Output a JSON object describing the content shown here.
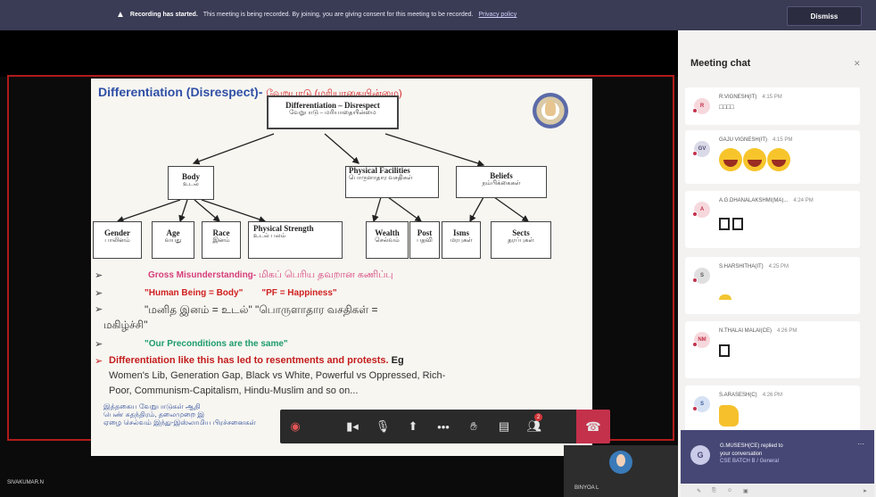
{
  "banner": {
    "title": "Recording has started.",
    "message": "This meeting is being recorded. By joining, you are giving consent for this meeting to be recorded.",
    "link": "Privacy policy",
    "dismiss": "Dismiss"
  },
  "slide": {
    "title_en": "Differentiation (Disrespect)-",
    "title_ta": "வேறுபாடு (மரியாதையின்மை)",
    "top_box": {
      "en": "Differentiation",
      "en2": "– Disrespect",
      "ta": "வேறுபாடு – மரியாதையின்மை"
    },
    "mid_boxes": [
      {
        "en": "Body",
        "ta": "உடல்"
      },
      {
        "en": "Physical Facilities",
        "ta": "பொருளாதார வசதிகள்"
      },
      {
        "en": "Beliefs",
        "ta": "நம்பிக்கைகள்"
      }
    ],
    "leaf_boxes": [
      {
        "en": "Gender",
        "ta": "பாலினம்"
      },
      {
        "en": "Age",
        "ta": "வயது"
      },
      {
        "en": "Race",
        "ta": "இனம்"
      },
      {
        "en": "Physical Strength",
        "ta": "உடல் பலம்"
      },
      {
        "en": "Wealth",
        "ta": "செல்வம்"
      },
      {
        "en": "Post",
        "ta": "பதவி"
      },
      {
        "en": "Isms",
        "ta": "மரபுகள்"
      },
      {
        "en": "Sects",
        "ta": "தரப்புகள்"
      }
    ],
    "bullet1_en": "Gross Misunderstanding-",
    "bullet1_ta": "மிகப் பெரிய தவறான கணிப்பு",
    "bullet2a": "\"Human Being = Body\"",
    "bullet2b": "\"PF = Happiness\"",
    "bullet3_line1": "\"மனித இனம் = உடல்\" \"பொருளாதார வசதிகள் =",
    "bullet3_line2": "மகிழ்ச்சி\"",
    "bullet4": "\"Our Preconditions are the same\"",
    "bullet5_red": "Differentiation like this has led to resentments and protests.",
    "bullet5_eg": "Eg",
    "bullet5_line2": "Women's Lib, Generation Gap, Black vs White, Powerful vs Oppressed, Rich-",
    "bullet5_line3": "Poor, Communism-Capitalism, Hindu-Muslim and so on...",
    "bottom_ta1": "இத்தகைய வேறுபாடுகள் ஆதி",
    "bottom_ta2": "பெண் சுதந்திரம், தலைமுறை இ",
    "bottom_ta3": "ஏழை செல்வம் இந்து-இஸ்லாமிய பிரச்சனைகள்"
  },
  "controls": {
    "items": [
      "record-icon",
      "camera-icon",
      "mic-icon",
      "share-icon",
      "more-icon",
      "raise-hand-icon",
      "chat-icon",
      "participants-icon",
      "hangup-icon"
    ],
    "participants_badge": "2"
  },
  "self_view": {
    "name": "BINYOA L"
  },
  "bottom_name": "SIVAKUMAR.N",
  "chat": {
    "title": "Meeting chat",
    "messages": [
      {
        "initials": "R",
        "name": "R.VIGNESH(IT)",
        "time": "4:15 PM",
        "body": "□□□□",
        "avatar_bg": "#f6d8dc",
        "avatar_fg": "#c4314b"
      },
      {
        "initials": "GV",
        "name": "GAJU VIGNESH(IT)",
        "time": "4:15 PM",
        "body": "laugh-emoji x3",
        "avatar_bg": "#d9d9e8",
        "avatar_fg": "#4a4a70"
      },
      {
        "initials": "A",
        "name": "A.G.DHANALAKSHMI(MA)...",
        "time": "4:24 PM",
        "body": "□□",
        "avatar_bg": "#f6d8dc",
        "avatar_fg": "#c4314b"
      },
      {
        "initials": "S",
        "name": "S.HARSHITHA(IT)",
        "time": "4:25 PM",
        "body": "bulb-emoji",
        "avatar_bg": "#dfdfdf",
        "avatar_fg": "#555"
      },
      {
        "initials": "NM",
        "name": "N.THALAI MALAI(CE)",
        "time": "4:26 PM",
        "body": "□",
        "avatar_bg": "#f6d8dc",
        "avatar_fg": "#c4314b"
      },
      {
        "initials": "S",
        "name": "S.ARASESH(C)",
        "time": "4:26 PM",
        "body": "thumbs-up-emoji",
        "avatar_bg": "#d6e2f4",
        "avatar_fg": "#3a5c9a"
      }
    ],
    "toast": {
      "initial": "G",
      "line1": "G.MUSESH(CE) replied to",
      "line2": "your conversation",
      "line3": "CSE BATCH B / General"
    }
  },
  "colors": {
    "banner": "#3a3b54",
    "accent": "#464775",
    "hangup": "#c4314b"
  }
}
